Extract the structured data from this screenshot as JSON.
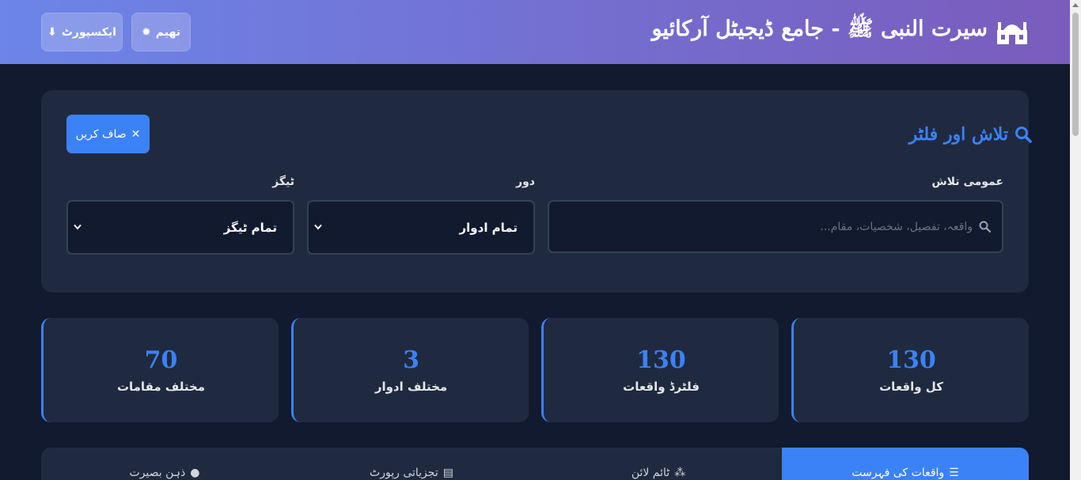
{
  "header": {
    "title": "سیرت النبی ﷺ - جامع ڈیجیٹل آرکائیو",
    "theme_label": "تھیم",
    "export_label": "ایکسپورٹ"
  },
  "filters": {
    "title": "تلاش اور فلٹر",
    "clear_label": "صاف کریں",
    "search_label": "عمومی تلاش",
    "search_placeholder": "واقعہ، تفصیل، شخصیات، مقام...",
    "era_label": "دور",
    "era_value": "تمام ادوار",
    "tags_label": "ٹیگز",
    "tags_value": "تمام ٹیگز"
  },
  "stats": [
    {
      "value": "130",
      "label": "کل واقعات"
    },
    {
      "value": "130",
      "label": "فلٹرڈ واقعات"
    },
    {
      "value": "3",
      "label": "مختلف ادوار"
    },
    {
      "value": "70",
      "label": "مختلف مقامات"
    }
  ],
  "tabs": [
    {
      "label": "واقعات کی فہرست",
      "icon": "list-icon",
      "active": true
    },
    {
      "label": "ٹائم لائن",
      "icon": "timeline-icon",
      "active": false
    },
    {
      "label": "تجزیاتی رپورٹ",
      "icon": "chart-icon",
      "active": false
    },
    {
      "label": "ذہن بصیرت",
      "icon": "lightbulb-icon",
      "active": false
    }
  ],
  "colors": {
    "accent": "#3b82f6",
    "header_start": "#6c85e8",
    "header_end": "#7a5cbc",
    "background": "#111a2e",
    "card": "#1f2a40"
  }
}
